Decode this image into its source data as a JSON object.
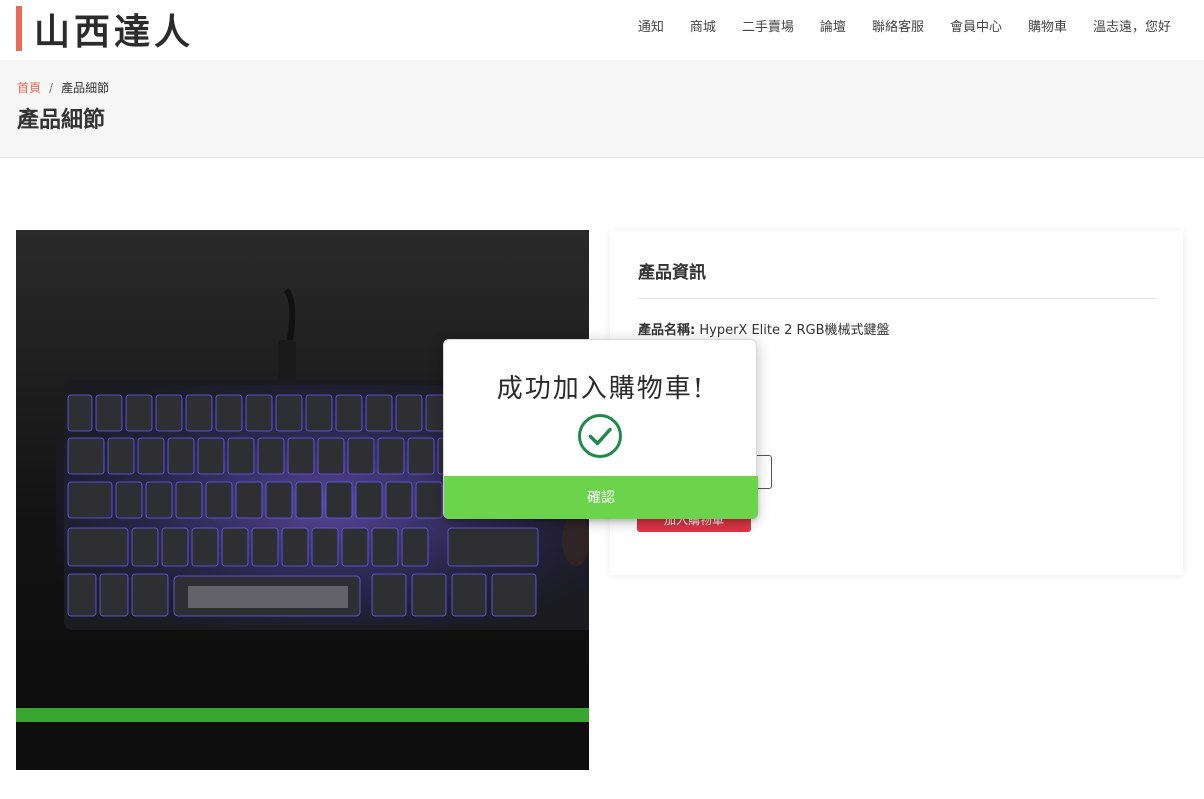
{
  "brand": {
    "logo_text": "山西達人",
    "accent": "#e96b56"
  },
  "nav": {
    "items": [
      "通知",
      "商城",
      "二手賣場",
      "論壇",
      "聯絡客服",
      "會員中心",
      "購物車",
      "溫志遠，您好"
    ]
  },
  "breadcrumb": {
    "home": "首頁",
    "separator": "/",
    "current": "產品細節"
  },
  "page": {
    "title": "產品細節"
  },
  "product": {
    "image_icon": "keyboard-photo",
    "info_title": "產品資訊",
    "name_label": "產品名稱:",
    "name_value": "HyperX Elite 2 RGB機械式鍵盤",
    "add_to_cart_label": "加入購物車",
    "add_to_cart_color": "#dc3545"
  },
  "modal": {
    "title": "成功加入購物車!",
    "icon": "check-circle-icon",
    "icon_color": "#1f8a4c",
    "confirm_label": "確認",
    "confirm_color": "#6cd34d"
  }
}
